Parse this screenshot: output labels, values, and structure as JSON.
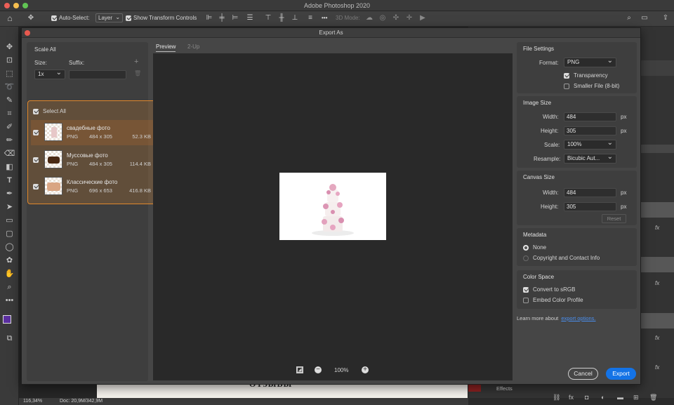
{
  "app": {
    "title": "Adobe Photoshop 2020"
  },
  "options_bar": {
    "auto_select_label": "Auto-Select:",
    "auto_select_value": "Layer",
    "transform_label": "Show Transform Controls",
    "mode_3d": "3D Mode:",
    "more": "•••"
  },
  "dialog": {
    "title": "Export As",
    "scale_all": "Scale All",
    "size_label": "Size:",
    "suffix_label": "Suffix:",
    "size_value": "1x",
    "select_all": "Select All",
    "assets": [
      {
        "name": "свадебные фото",
        "format": "PNG",
        "dims": "484 x 305",
        "size": "52.3 KB"
      },
      {
        "name": "Муссовые фото",
        "format": "PNG",
        "dims": "484 x 305",
        "size": "114.4 KB"
      },
      {
        "name": "Классические фото",
        "format": "PNG",
        "dims": "696 x 653",
        "size": "416.8 KB"
      }
    ],
    "tabs": {
      "preview": "Preview",
      "two_up": "2-Up"
    },
    "zoom": "100%",
    "file_settings": {
      "title": "File Settings",
      "format_label": "Format:",
      "format_value": "PNG",
      "transparency": "Transparency",
      "smaller_file": "Smaller File (8-bit)"
    },
    "image_size": {
      "title": "Image Size",
      "width_label": "Width:",
      "width": "484",
      "height_label": "Height:",
      "height": "305",
      "scale_label": "Scale:",
      "scale": "100%",
      "resample_label": "Resample:",
      "resample": "Bicubic Aut...",
      "unit": "px"
    },
    "canvas_size": {
      "title": "Canvas Size",
      "width_label": "Width:",
      "width": "484",
      "height_label": "Height:",
      "height": "305",
      "unit": "px",
      "reset": "Reset"
    },
    "metadata": {
      "title": "Metadata",
      "none": "None",
      "copyright": "Copyright and Contact Info"
    },
    "color_space": {
      "title": "Color Space",
      "convert": "Convert to sRGB",
      "embed": "Embed Color Profile"
    },
    "learn_more": "Learn more about",
    "export_options_link": "export options.",
    "cancel": "Cancel",
    "export": "Export"
  },
  "right_panel": {
    "effects": "Effects",
    "fx": "fx"
  },
  "status": {
    "zoom": "116,34%",
    "doc": "Doc: 20,9M/342,9M"
  },
  "document": {
    "visible_text": "ОТЗЫВЫ"
  },
  "colors": {
    "accent_blue": "#1473e6",
    "highlight_orange": "#e0882c",
    "foreground": "#5b2fa0"
  }
}
